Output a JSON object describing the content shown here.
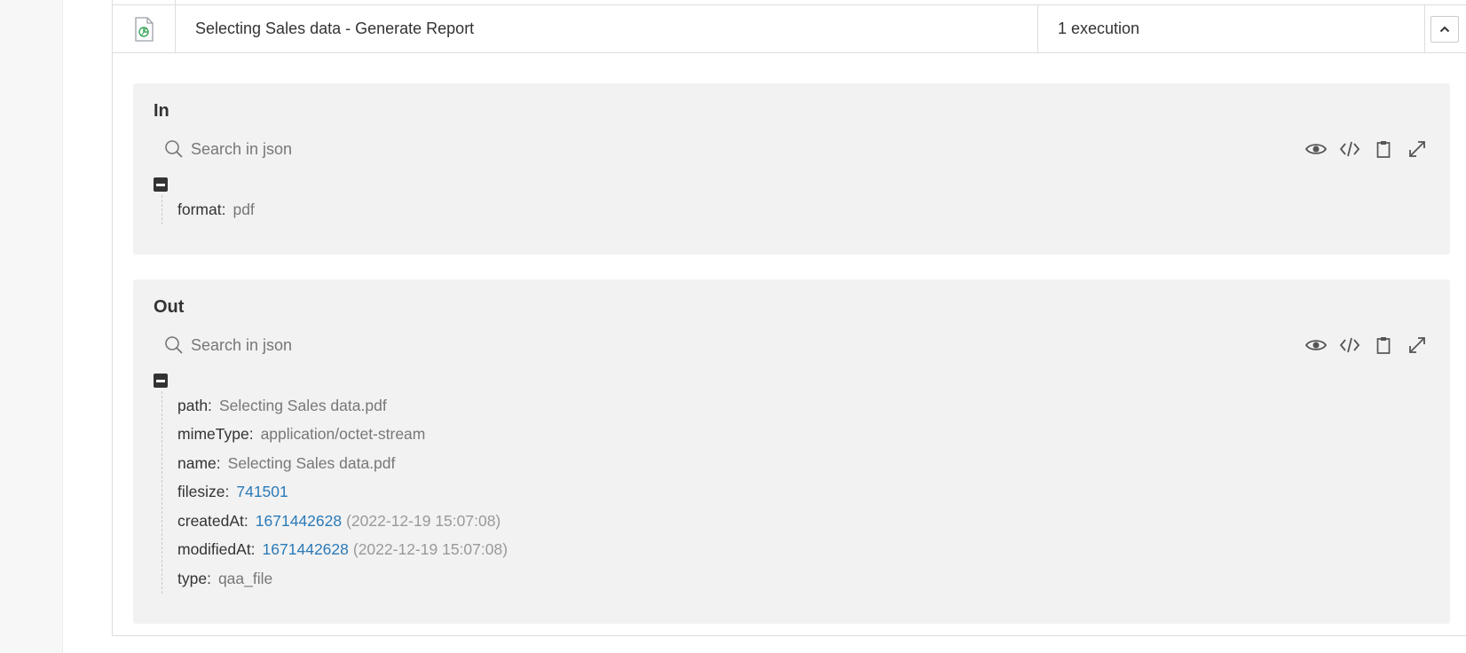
{
  "row": {
    "name": "Selecting Sales data - Generate Report",
    "executions": "1 execution",
    "icon": "document-chart-icon",
    "toggle_icon": "chevron-up-icon"
  },
  "in_block": {
    "title": "In",
    "search_placeholder": "Search in json",
    "entries": [
      {
        "key": "format:",
        "value": "pdf"
      }
    ]
  },
  "out_block": {
    "title": "Out",
    "search_placeholder": "Search in json",
    "entries": {
      "path": {
        "key": "path:",
        "value": "Selecting Sales data.pdf"
      },
      "mimeType": {
        "key": "mimeType:",
        "value": "application/octet-stream"
      },
      "name": {
        "key": "name:",
        "value": "Selecting Sales data.pdf"
      },
      "filesize": {
        "key": "filesize:",
        "value": "741501"
      },
      "createdAt": {
        "key": "createdAt:",
        "value": "1671442628",
        "date": "(2022-12-19 15:07:08)"
      },
      "modifiedAt": {
        "key": "modifiedAt:",
        "value": "1671442628",
        "date": "(2022-12-19 15:07:08)"
      },
      "type": {
        "key": "type:",
        "value": "qaa_file"
      }
    }
  },
  "toolbar_icons": [
    "eye-icon",
    "code-icon",
    "clipboard-icon",
    "expand-icon"
  ],
  "colors": {
    "block_bg": "#f2f2f2",
    "number": "#2a7ab8",
    "string": "#777777",
    "icon_green": "#3aa65a"
  }
}
